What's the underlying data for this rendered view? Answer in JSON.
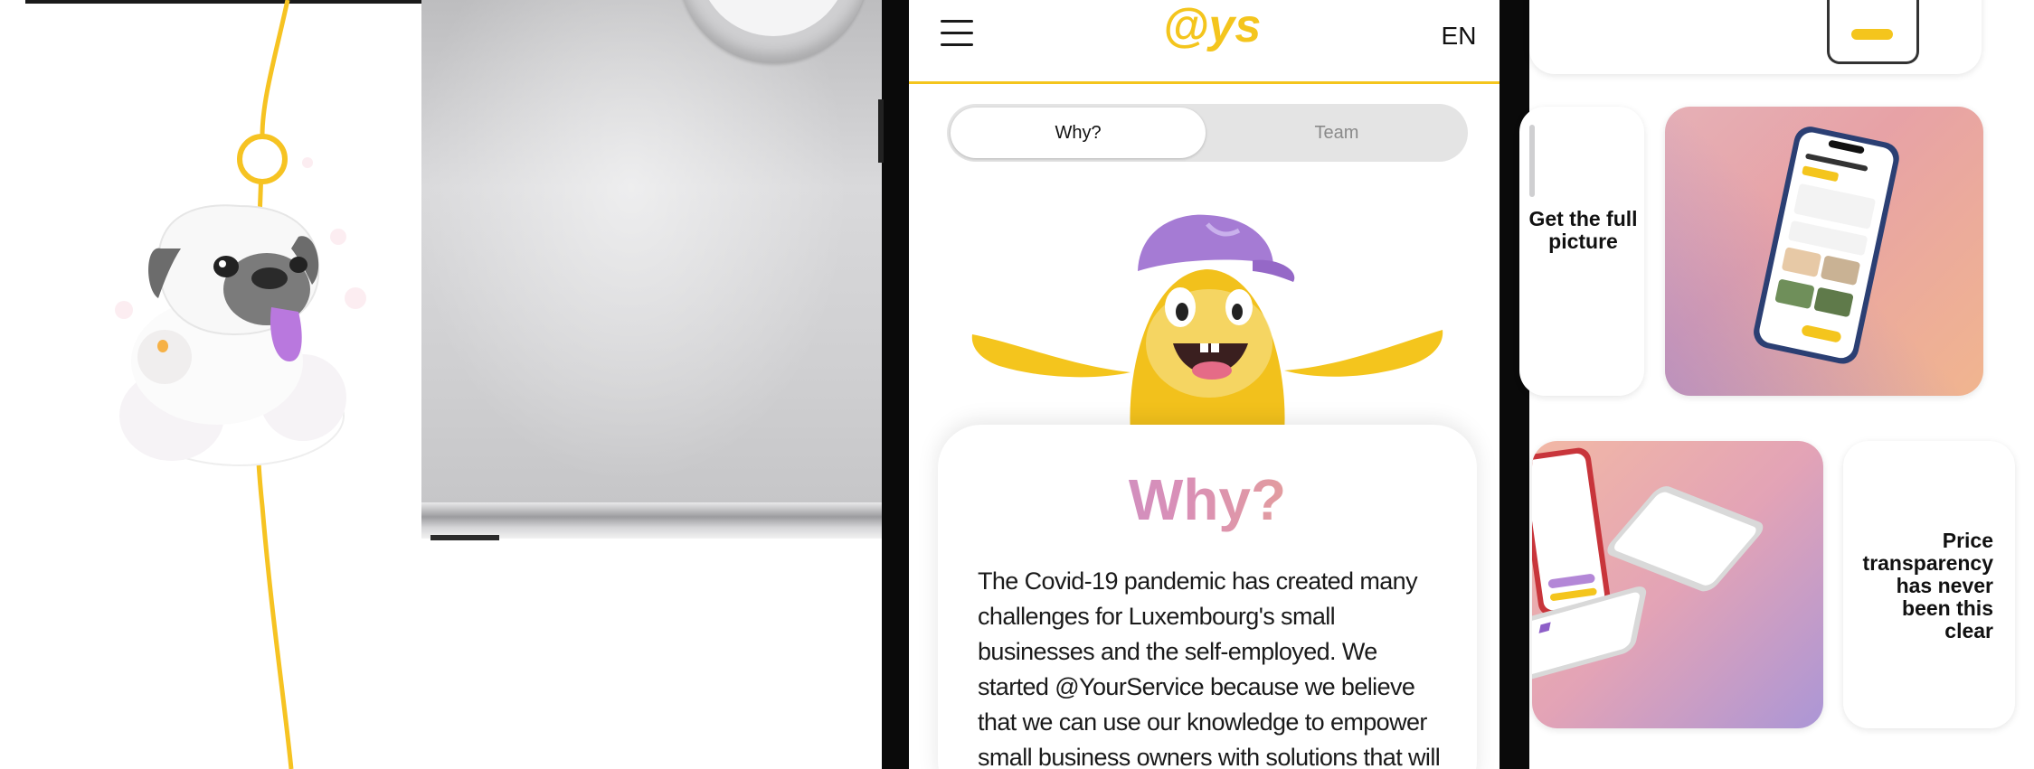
{
  "brand": {
    "logo_text": "@ys",
    "accent_color": "#f4c51d",
    "heading_gradient": [
      "#b88fd7",
      "#f3b473"
    ]
  },
  "phone": {
    "header": {
      "menu_icon": "hamburger-menu-icon",
      "language": "EN"
    },
    "tabs": [
      {
        "label": "Why?",
        "active": true
      },
      {
        "label": "Team",
        "active": false
      }
    ],
    "card": {
      "heading": "Why?",
      "body": "The Covid-19 pandemic has created many challenges for Luxembourg's small businesses and the self-employed. We started @YourService because we believe that we can use our knowledge to empower small business owners with solutions that will"
    }
  },
  "right_cards": {
    "full_picture_label": "Get the full picture",
    "price_label": "Price transparency has never been this clear"
  }
}
